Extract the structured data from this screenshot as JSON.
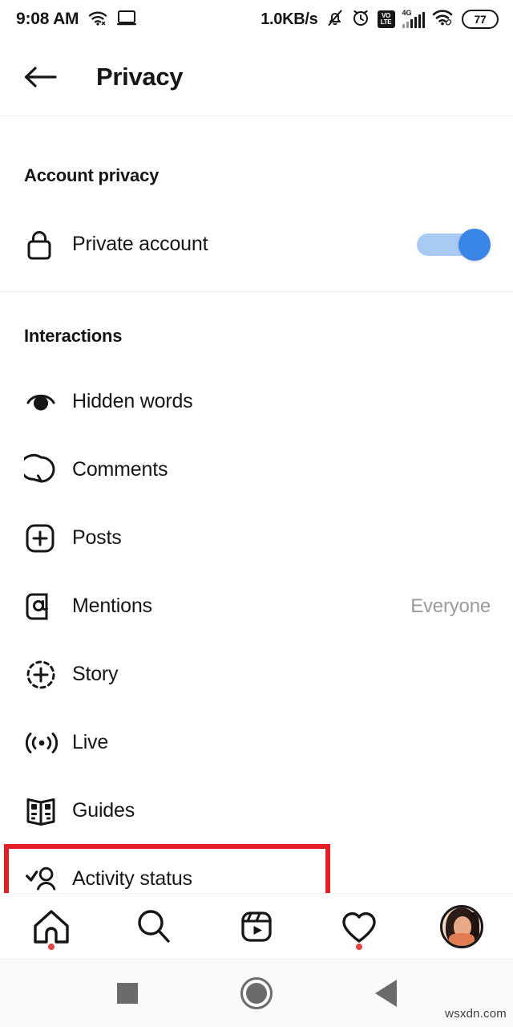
{
  "statusbar": {
    "time": "9:08 AM",
    "wifi_left_icon": "wifi-icon",
    "cast_icon": "screencast-icon",
    "network_speed": "1.0KB/s",
    "mute_icon": "bell-muted-icon",
    "alarm_icon": "alarm-clock-icon",
    "volte_top": "VO",
    "volte_bottom": "LTE",
    "network_gen": "4G",
    "signal_icon": "signal-bars-icon",
    "wifi_icon": "wifi-link-icon",
    "battery_level": "77"
  },
  "header": {
    "back_icon": "arrow-left-icon",
    "title": "Privacy"
  },
  "sections": [
    {
      "title": "Account privacy",
      "rows": [
        {
          "label": "Private account",
          "icon": "lock-icon",
          "control": "toggle",
          "toggle_on": true
        }
      ]
    },
    {
      "title": "Interactions",
      "rows": [
        {
          "label": "Hidden words",
          "icon": "hidden-eye-icon",
          "value": ""
        },
        {
          "label": "Comments",
          "icon": "comment-bubble-icon",
          "value": ""
        },
        {
          "label": "Posts",
          "icon": "post-plus-icon",
          "value": ""
        },
        {
          "label": "Mentions",
          "icon": "at-sign-icon",
          "value": "Everyone"
        },
        {
          "label": "Story",
          "icon": "story-plus-icon",
          "value": ""
        },
        {
          "label": "Live",
          "icon": "live-broadcast-icon",
          "value": ""
        },
        {
          "label": "Guides",
          "icon": "open-book-icon",
          "value": ""
        },
        {
          "label": "Activity status",
          "icon": "person-check-icon",
          "value": "",
          "highlighted": true
        }
      ]
    }
  ],
  "bottom_nav": [
    {
      "name": "home-icon",
      "badge": true
    },
    {
      "name": "search-icon",
      "badge": false
    },
    {
      "name": "reels-icon",
      "badge": false
    },
    {
      "name": "heart-icon",
      "badge": true
    },
    {
      "name": "profile-avatar",
      "badge": false
    }
  ],
  "android_nav": {
    "recents_icon": "square-recents-icon",
    "home_icon": "circle-home-icon",
    "back_icon": "triangle-back-icon"
  },
  "watermark": "wsxdn.com",
  "colors": {
    "accent_blue": "#3a86e8",
    "track_blue": "#a8cbf4",
    "highlight_red": "#e01f26",
    "badge_red": "#e8414a",
    "text_primary": "#161616",
    "text_muted": "#9a9a9a"
  }
}
